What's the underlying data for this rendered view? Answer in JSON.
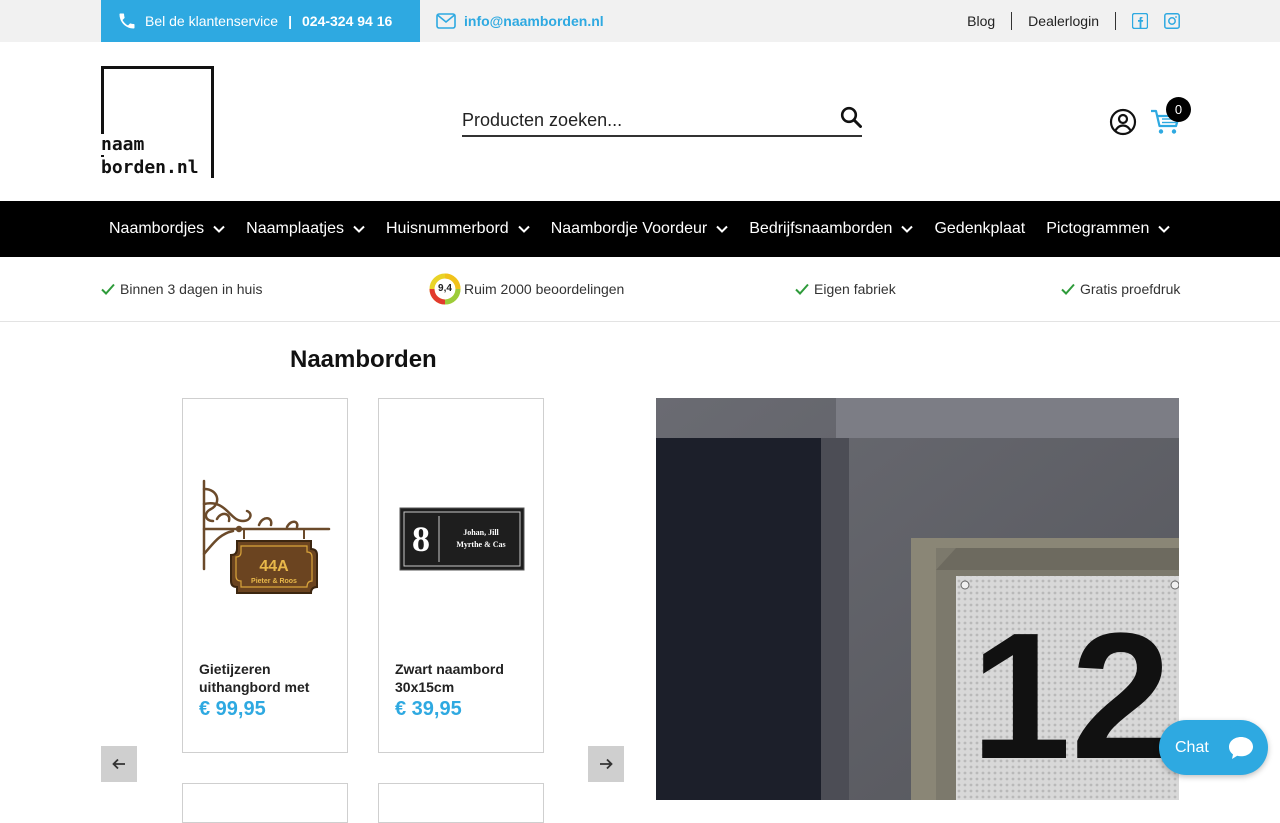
{
  "topbar": {
    "phone_label": "Bel de klantenservice",
    "phone_sep": "|",
    "phone_number": "024-324 94 16",
    "email": "info@naamborden.nl",
    "links": {
      "blog": "Blog",
      "dealer": "Dealerlogin"
    },
    "social": [
      "facebook-icon",
      "instagram-icon"
    ]
  },
  "header": {
    "logo_line1": "naam",
    "logo_line2": "borden.nl",
    "search_placeholder": "Producten zoeken...",
    "cart_count": "0"
  },
  "nav": {
    "items": [
      {
        "label": "Naambordjes",
        "has_dropdown": true
      },
      {
        "label": "Naamplaatjes",
        "has_dropdown": true
      },
      {
        "label": "Huisnummerbord",
        "has_dropdown": true
      },
      {
        "label": "Naambordje Voordeur",
        "has_dropdown": true
      },
      {
        "label": "Bedrijfsnaamborden",
        "has_dropdown": true
      },
      {
        "label": "Gedenkplaat",
        "has_dropdown": false
      },
      {
        "label": "Pictogrammen",
        "has_dropdown": true
      }
    ]
  },
  "usp": {
    "delivery": "Binnen 3 dagen in huis",
    "rating_score": "9,4",
    "reviews": "Ruim 2000 beoordelingen",
    "factory": "Eigen fabriek",
    "proof": "Gratis proefdruk"
  },
  "section": {
    "title": "Naamborden"
  },
  "products": [
    {
      "name": "Gietijzeren uithangbord met",
      "price": "€ 99,95",
      "plate_num": "44A",
      "plate_text": "Pieter & Roos"
    },
    {
      "name": "Zwart naambord 30x15cm",
      "price": "€ 39,95",
      "plate_num": "8",
      "plate_text1": "Johan, Jill",
      "plate_text2": "Myrthe & Cas"
    }
  ],
  "hero": {
    "house_number": "12"
  },
  "chat": {
    "label": "Chat"
  },
  "colors": {
    "accent": "#2ea9e1",
    "nav_bg": "#000000",
    "topbar_bg": "#f1f1f1",
    "check": "#2e9b3a"
  }
}
